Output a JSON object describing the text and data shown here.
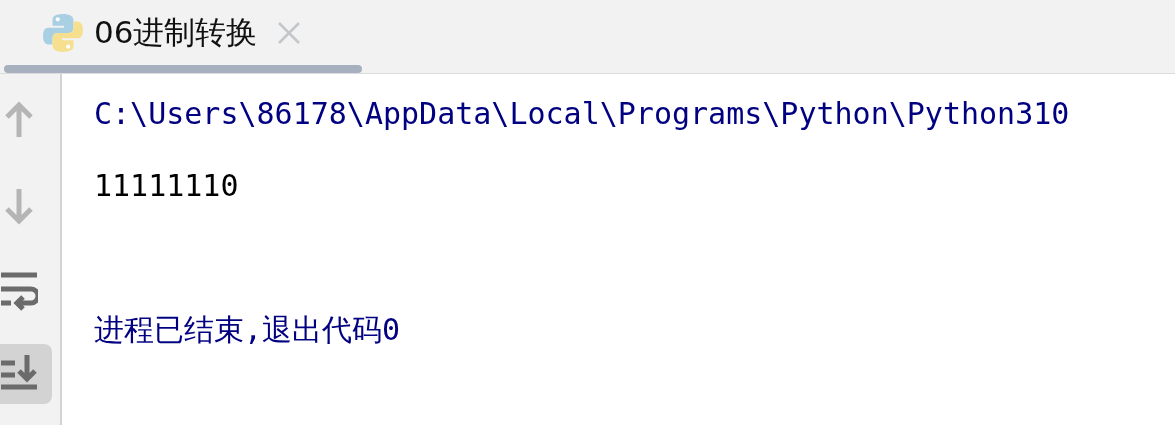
{
  "tab": {
    "title": "06进制转换",
    "selected": true
  },
  "toolbar": [
    {
      "kind": "up",
      "disabled": true,
      "on": false
    },
    {
      "kind": "down",
      "disabled": true,
      "on": false
    },
    {
      "kind": "wrap",
      "disabled": false,
      "on": false
    },
    {
      "kind": "scroll-end",
      "disabled": false,
      "on": true
    }
  ],
  "console": [
    {
      "kind": "system",
      "text": "C:\\Users\\86178\\AppData\\Local\\Programs\\Python\\Python310"
    },
    {
      "kind": "output",
      "text": "11111110"
    },
    {
      "kind": "exit",
      "text": "进程已结束,退出代码0"
    }
  ]
}
